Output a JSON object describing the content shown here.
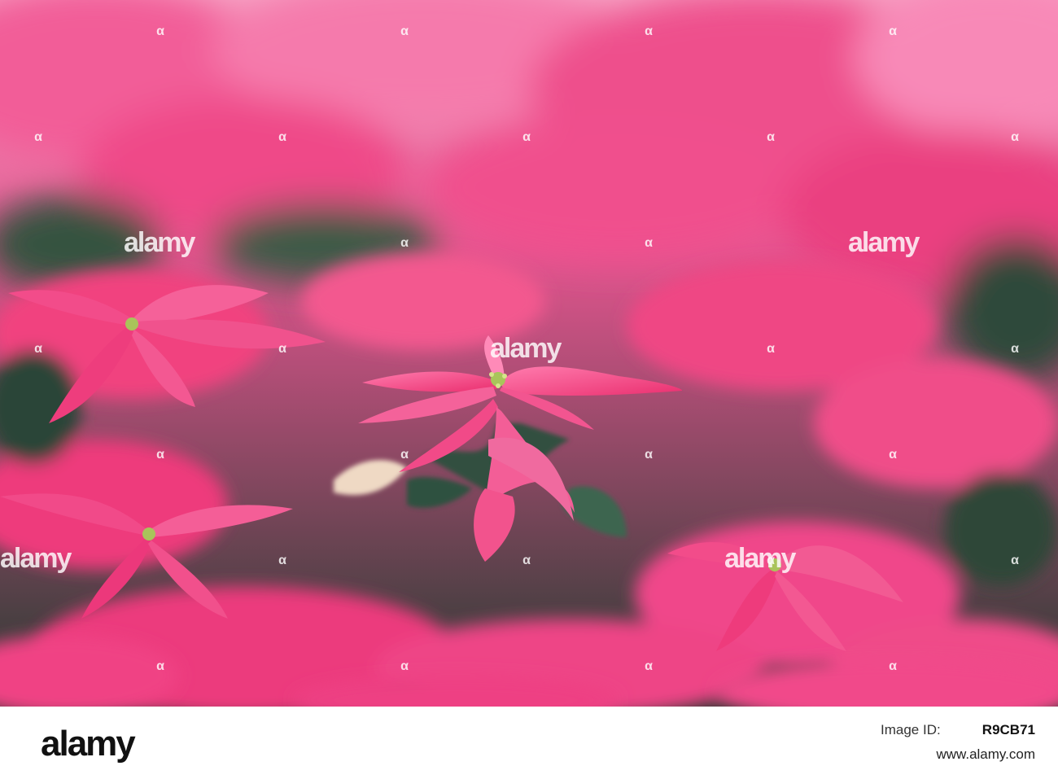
{
  "photo": {
    "subject": "pink poinsettia plants",
    "colors": {
      "bracts": "#f0427f",
      "bracts_light": "#ff86b4",
      "foliage": "#2f4a3c",
      "cyathia": "#a9c45a"
    }
  },
  "watermark": {
    "text": "alamy",
    "icon": "alamy-dot-icon"
  },
  "footer": {
    "brand": "alamy",
    "image_id_label": "Image ID:",
    "image_id": "R9CB71",
    "site": "www.alamy.com"
  }
}
